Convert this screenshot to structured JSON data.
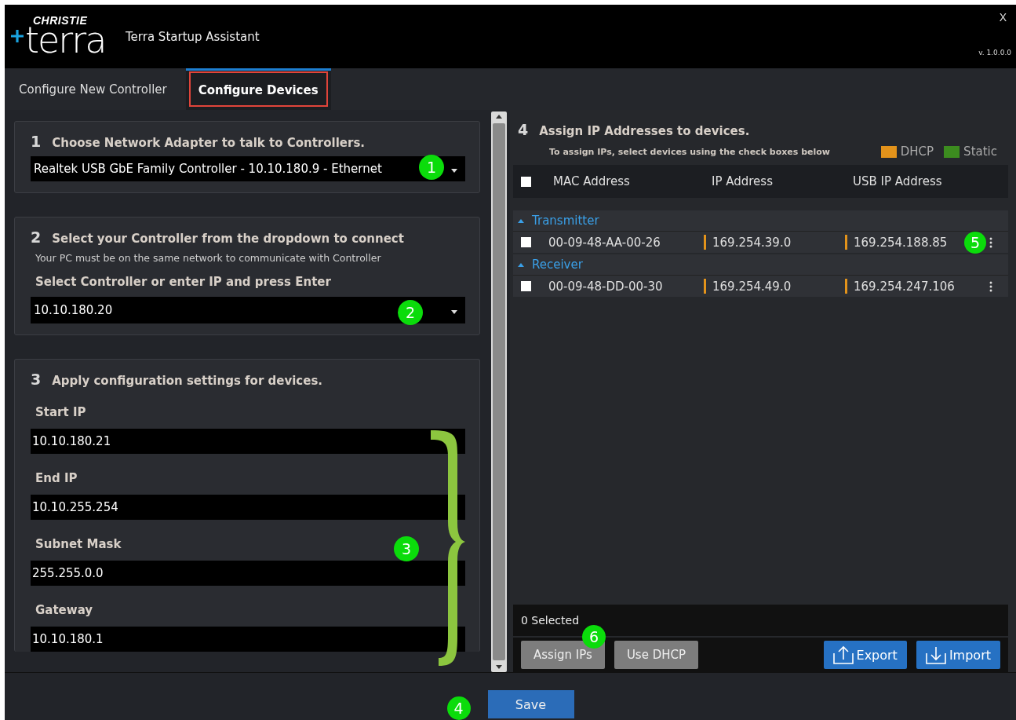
{
  "window": {
    "brand": "CHRISTIE",
    "logo_text": "terra",
    "title": "Terra Startup Assistant",
    "close": "X",
    "version": "v. 1.0.0.0"
  },
  "tabs": [
    {
      "label": "Configure New Controller",
      "selected": false
    },
    {
      "label": "Configure Devices",
      "selected": true
    }
  ],
  "step1": {
    "number": "1",
    "title": "Choose Network Adapter to talk to Controllers.",
    "value": "Realtek USB GbE Family Controller - 10.10.180.9 - Ethernet",
    "callout": "1"
  },
  "step2": {
    "number": "2",
    "title": "Select your Controller from the dropdown to connect",
    "hint": "Your PC must be on the same network to communicate with Controller",
    "label": "Select Controller or enter IP and press Enter",
    "value": "10.10.180.20",
    "callout": "2"
  },
  "step3": {
    "number": "3",
    "title": "Apply configuration settings for devices.",
    "callout": "3",
    "fields": [
      {
        "label": "Start IP",
        "value": "10.10.180.21"
      },
      {
        "label": "End IP",
        "value": "10.10.255.254"
      },
      {
        "label": "Subnet Mask",
        "value": "255.255.0.0"
      },
      {
        "label": "Gateway",
        "value": "10.10.180.1"
      }
    ]
  },
  "devices": {
    "number": "4",
    "title": "Assign IP Addresses to devices.",
    "hint": "To assign IPs, select devices using the check boxes below",
    "legend": [
      {
        "label": "DHCP",
        "color": "#e3931b"
      },
      {
        "label": "Static",
        "color": "#3c8c1f"
      }
    ],
    "select_all": false,
    "columns": [
      "MAC Address",
      "IP Address",
      "USB IP Address"
    ],
    "groups": [
      {
        "name": "Transmitter",
        "expanded": true,
        "rows": [
          {
            "checked": false,
            "mac": "00-09-48-AA-00-26",
            "ip": {
              "value": "169.254.39.0",
              "color": "#e3931b"
            },
            "usb_ip": {
              "value": "169.254.188.85",
              "color": "#e3931b"
            },
            "callout": "5"
          }
        ]
      },
      {
        "name": "Receiver",
        "expanded": true,
        "rows": [
          {
            "checked": false,
            "mac": "00-09-48-DD-00-30",
            "ip": {
              "value": "169.254.49.0",
              "color": "#e3931b"
            },
            "usb_ip": {
              "value": "169.254.247.106",
              "color": "#e3931b"
            }
          }
        ]
      }
    ],
    "selected_count": "0 Selected",
    "buttons": [
      {
        "label": "Assign IPs",
        "kind": "grey",
        "callout": "6"
      },
      {
        "label": "Use DHCP",
        "kind": "grey"
      },
      {
        "label": "Export",
        "kind": "export"
      },
      {
        "label": "Import",
        "kind": "import"
      }
    ]
  },
  "footer": {
    "save": "Save",
    "callout": "4"
  }
}
